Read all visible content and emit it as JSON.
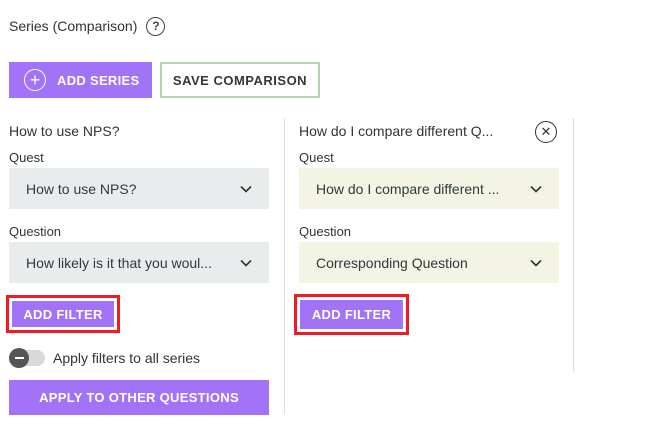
{
  "header": {
    "title": "Series (Comparison)",
    "help_icon": "question-mark-icon",
    "help_glyph": "?"
  },
  "toolbar": {
    "add_series_label": "ADD SERIES",
    "add_icon": "plus-circle-icon",
    "save_label": "SAVE COMPARISON"
  },
  "series": [
    {
      "title": "How to use NPS?",
      "quest_label": "Quest",
      "quest_value": "How to use NPS?",
      "question_label": "Question",
      "question_value": "How likely is it that you woul...",
      "add_filter_label": "ADD FILTER"
    },
    {
      "title": "How do I compare different Q...",
      "quest_label": "Quest",
      "quest_value": "How do I compare different ...",
      "question_label": "Question",
      "question_value": "Corresponding Question",
      "add_filter_label": "ADD FILTER",
      "close_icon": "close-circle-icon",
      "close_glyph": "✕"
    }
  ],
  "apply_filters": {
    "label": "Apply filters to all series",
    "enabled": false
  },
  "apply_other_label": "APPLY TO OTHER QUESTIONS",
  "colors": {
    "accent": "#a273f6",
    "highlight": "#ee1c25",
    "select_gray": "#e9ecec",
    "select_cream": "#f3f4e4",
    "save_border": "#b7d1b3"
  }
}
